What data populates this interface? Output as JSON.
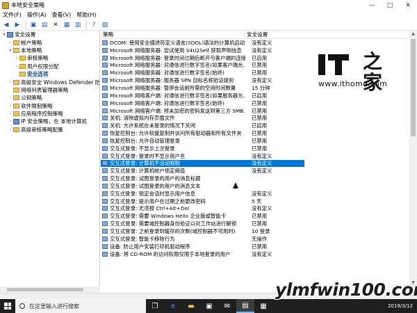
{
  "window": {
    "title": "本地安全策略"
  },
  "title_buttons": {
    "minimize": "—",
    "maximize": "□",
    "close": "✕"
  },
  "menu": [
    "文件(F)",
    "操作(A)",
    "查看(V)",
    "帮助(H)"
  ],
  "tree": [
    {
      "label": "安全设置",
      "level": 0,
      "twisty": "▾",
      "icon": "shield-icon"
    },
    {
      "label": "帐户策略",
      "level": 1,
      "twisty": "›",
      "icon": "folder-icon"
    },
    {
      "label": "本地策略",
      "level": 1,
      "twisty": "▾",
      "icon": "folder-icon"
    },
    {
      "label": "审核策略",
      "level": 2,
      "twisty": "›",
      "icon": "folder-icon"
    },
    {
      "label": "用户权限分配",
      "level": 2,
      "twisty": "›",
      "icon": "folder-icon"
    },
    {
      "label": "安全选项",
      "level": 2,
      "twisty": "",
      "icon": "folder-icon",
      "selected": true
    },
    {
      "label": "高级安全 Windows Defender 防火墙",
      "level": 1,
      "twisty": "›",
      "icon": "folder-icon"
    },
    {
      "label": "网络列表管理器策略",
      "level": 1,
      "twisty": "",
      "icon": "folder-icon"
    },
    {
      "label": "公钥策略",
      "level": 1,
      "twisty": "›",
      "icon": "folder-icon"
    },
    {
      "label": "软件限制策略",
      "level": 1,
      "twisty": "›",
      "icon": "folder-icon"
    },
    {
      "label": "应用程序控制策略",
      "level": 1,
      "twisty": "›",
      "icon": "folder-icon"
    },
    {
      "label": "IP 安全策略，在 本地计算机",
      "level": 1,
      "twisty": "›",
      "icon": "shield-icon"
    },
    {
      "label": "高级审核策略配置",
      "level": 1,
      "twisty": "›",
      "icon": "folder-icon"
    }
  ],
  "list_header": {
    "policy": "策略",
    "setting": "安全设置"
  },
  "rows": [
    {
      "name": "DCOM: 使用安全描述符定义语言(SDDL)语法的计算机启动...",
      "value": "没有定义"
    },
    {
      "name": "Microsoft 网络服务器: 尝试使用 S4U2Self 获取声明信息",
      "value": "没有定义"
    },
    {
      "name": "Microsoft 网络服务器: 登录时间过期后断开与客户端的连接",
      "value": "已启用"
    },
    {
      "name": "Microsoft 网络服务器: 对通信进行数字签名(如果客户端允...",
      "value": "已禁用"
    },
    {
      "name": "Microsoft 网络服务器: 对通信进行数字签名(始终)",
      "value": "已禁用"
    },
    {
      "name": "Microsoft 网络服务器: 服务器 SPN 目标名称验证级别",
      "value": "没有定义"
    },
    {
      "name": "Microsoft 网络服务器: 暂停会话前所需的空闲时间数量",
      "value": "15 分钟"
    },
    {
      "name": "Microsoft 网络客户端: 对通信进行数字签名(如果服务器允...",
      "value": "已启用"
    },
    {
      "name": "Microsoft 网络客户端: 对通信进行数字签名(始终)",
      "value": "已禁用"
    },
    {
      "name": "Microsoft 网络客户端: 将未加密的密码发送到第三方 SMB...",
      "value": "已禁用"
    },
    {
      "name": "关机: 清除虚拟内存页面文件",
      "value": "已禁用"
    },
    {
      "name": "关机: 允许系统在未登录的情况下关闭",
      "value": "已启用"
    },
    {
      "name": "恢复控制台: 允许软盘复制并访问所有驱动器和所有文件夹",
      "value": "已禁用"
    },
    {
      "name": "恢复控制台: 允许自动管理登录",
      "value": "已禁用"
    },
    {
      "name": "交互式登录: 不显示上次登录",
      "value": "已禁用"
    },
    {
      "name": "交互式登录: 登录时不显示用户名",
      "value": "没有定义"
    },
    {
      "name": "交互式登录: 计算机不活动限制",
      "value": "没有定义",
      "selected": true
    },
    {
      "name": "交互式登录: 计算机帐户锁定阈值",
      "value": "没有定义"
    },
    {
      "name": "交互式登录: 试图登录的用户的消息标题",
      "value": ""
    },
    {
      "name": "交互式登录: 试图登录的用户的消息文本",
      "value": ""
    },
    {
      "name": "交互式登录: 锁定会话时显示用户信息",
      "value": "没有定义"
    },
    {
      "name": "交互式登录: 提示用户在过期之前更改密码",
      "value": "5 天"
    },
    {
      "name": "交互式登录: 无须按 Ctrl+Alt+Del",
      "value": "没有定义"
    },
    {
      "name": "交互式登录: 需要 Windows Hello 企业版或智能卡",
      "value": "已禁用"
    },
    {
      "name": "交互式登录: 需要域控制器身份验证以对工作站进行解锁",
      "value": "已禁用"
    },
    {
      "name": "交互式登录: 之前登录到缓存的次数(域控制器不可用时)",
      "value": "10 登录"
    },
    {
      "name": "交互式登录: 智能卡移除行为",
      "value": "无操作"
    },
    {
      "name": "设备: 防止用户安装打印机驱动程序",
      "value": "已禁用"
    },
    {
      "name": "设备: 将 CD-ROM 的访问权限仅限于本地登录的用户",
      "value": "没有定义"
    }
  ],
  "taskbar": {
    "search_placeholder": "在这里输入进行搜索",
    "date": "2019/3/12"
  },
  "logo": {
    "glyph": "之家",
    "url": "www.ithome.com"
  },
  "watermark": "ylmfwin100.com"
}
